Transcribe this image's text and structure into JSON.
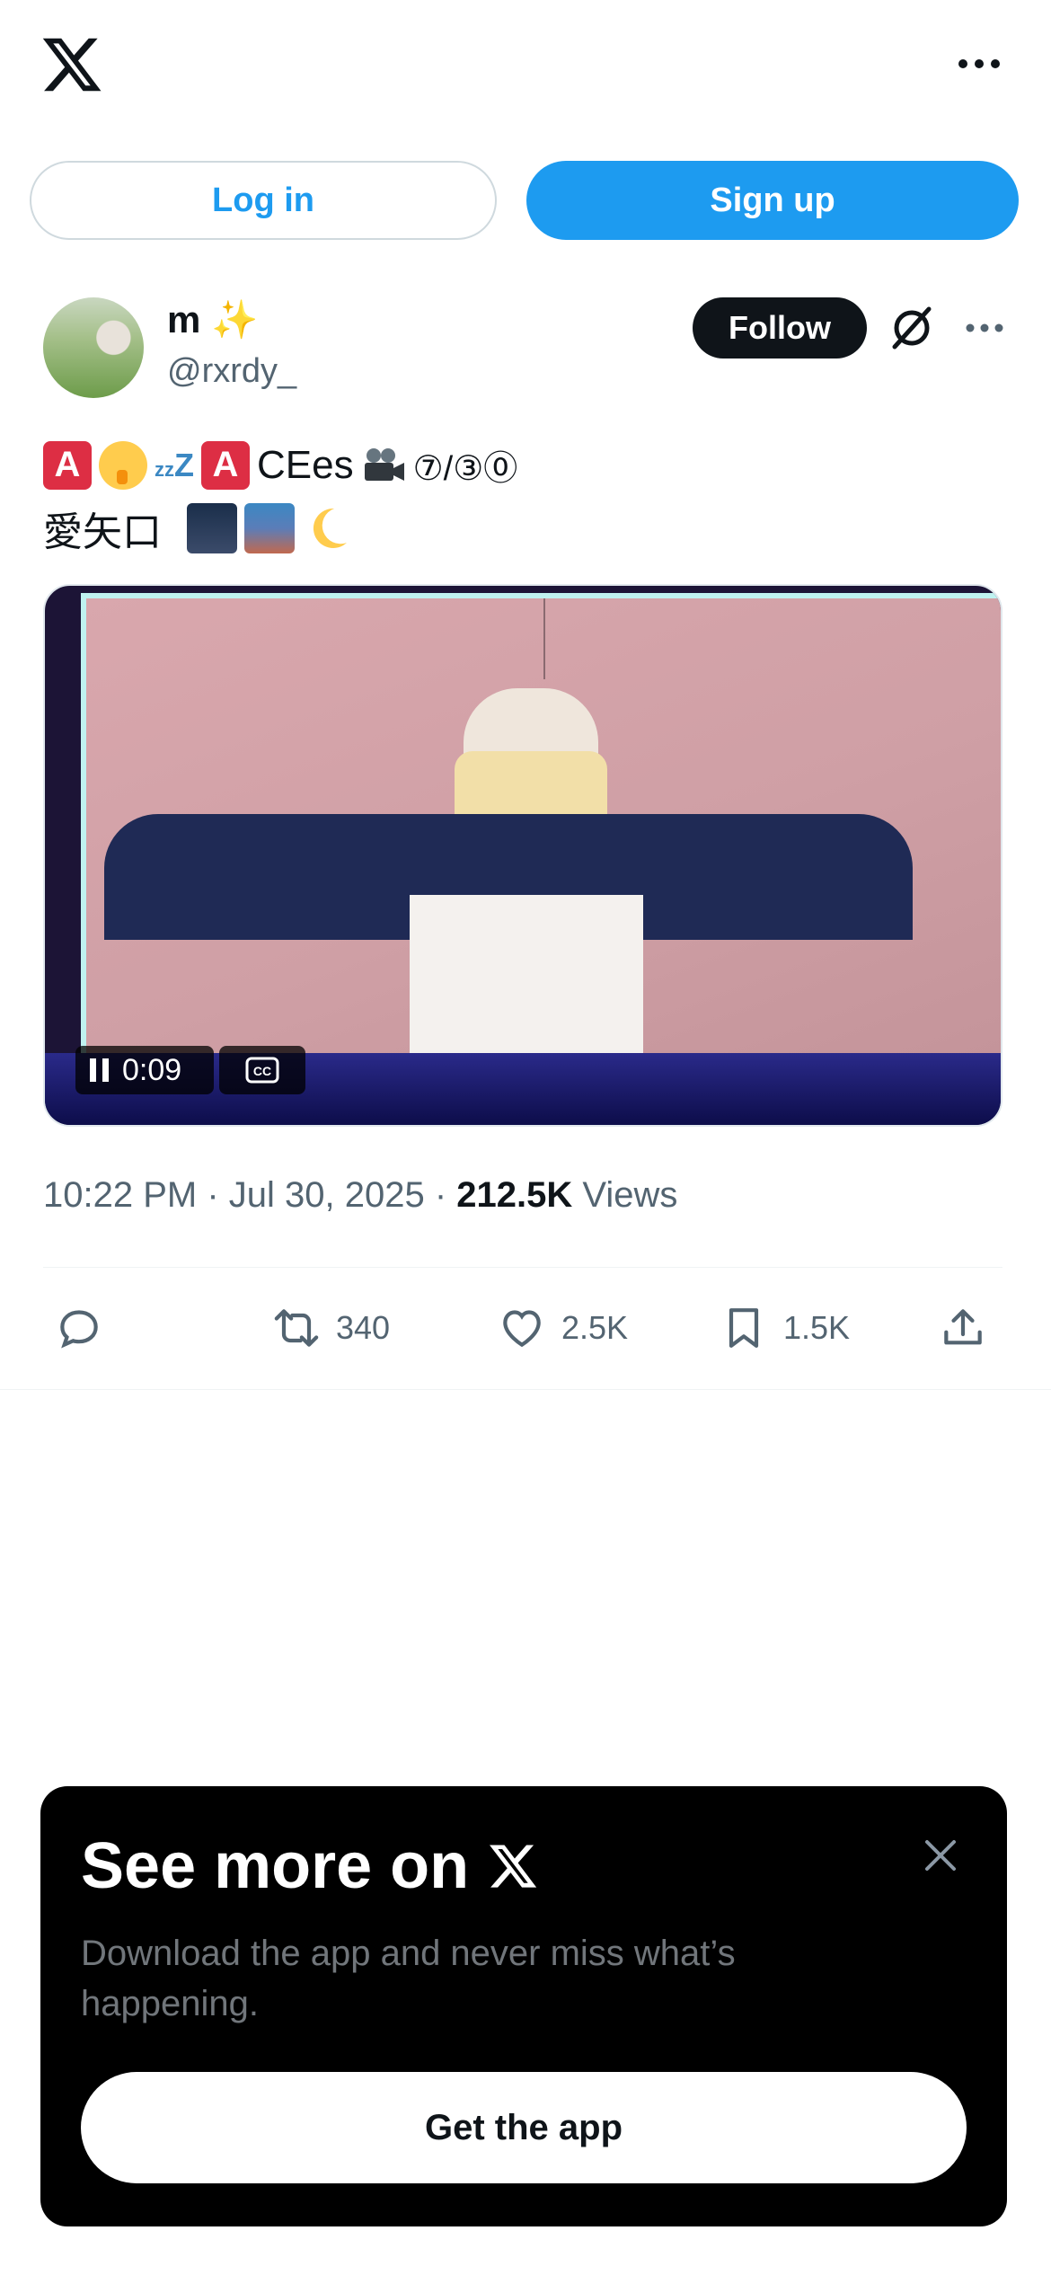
{
  "header": {
    "logo_icon": "x-logo-icon",
    "more_icon": "more-horizontal-icon",
    "login_label": "Log in",
    "signup_label": "Sign up"
  },
  "post": {
    "author": {
      "display_name": "m",
      "name_emoji": "✨",
      "handle": "@rxrdy_"
    },
    "follow_label": "Follow",
    "text_line1": {
      "a1": "A",
      "a2": "A",
      "word": "CEes",
      "numbers": "⑦/③⓪"
    },
    "text_line2": {
      "kanji": "愛矢口"
    },
    "video": {
      "time": "0:09",
      "cc_label": "CC"
    },
    "meta": {
      "time": "10:22 PM",
      "date": "Jul 30, 2025",
      "views_count": "212.5K",
      "views_label": "Views"
    },
    "actions": {
      "reply_count": "",
      "retweet_count": "340",
      "like_count": "2.5K",
      "bookmark_count": "1.5K"
    }
  },
  "banner": {
    "title": "See more on",
    "subtitle": "Download the app and never miss what’s happening.",
    "cta_label": "Get the app"
  },
  "colors": {
    "accent": "#1d9bf0",
    "text_primary": "#0f1419",
    "text_secondary": "#536471",
    "banner_bg": "#000000"
  }
}
